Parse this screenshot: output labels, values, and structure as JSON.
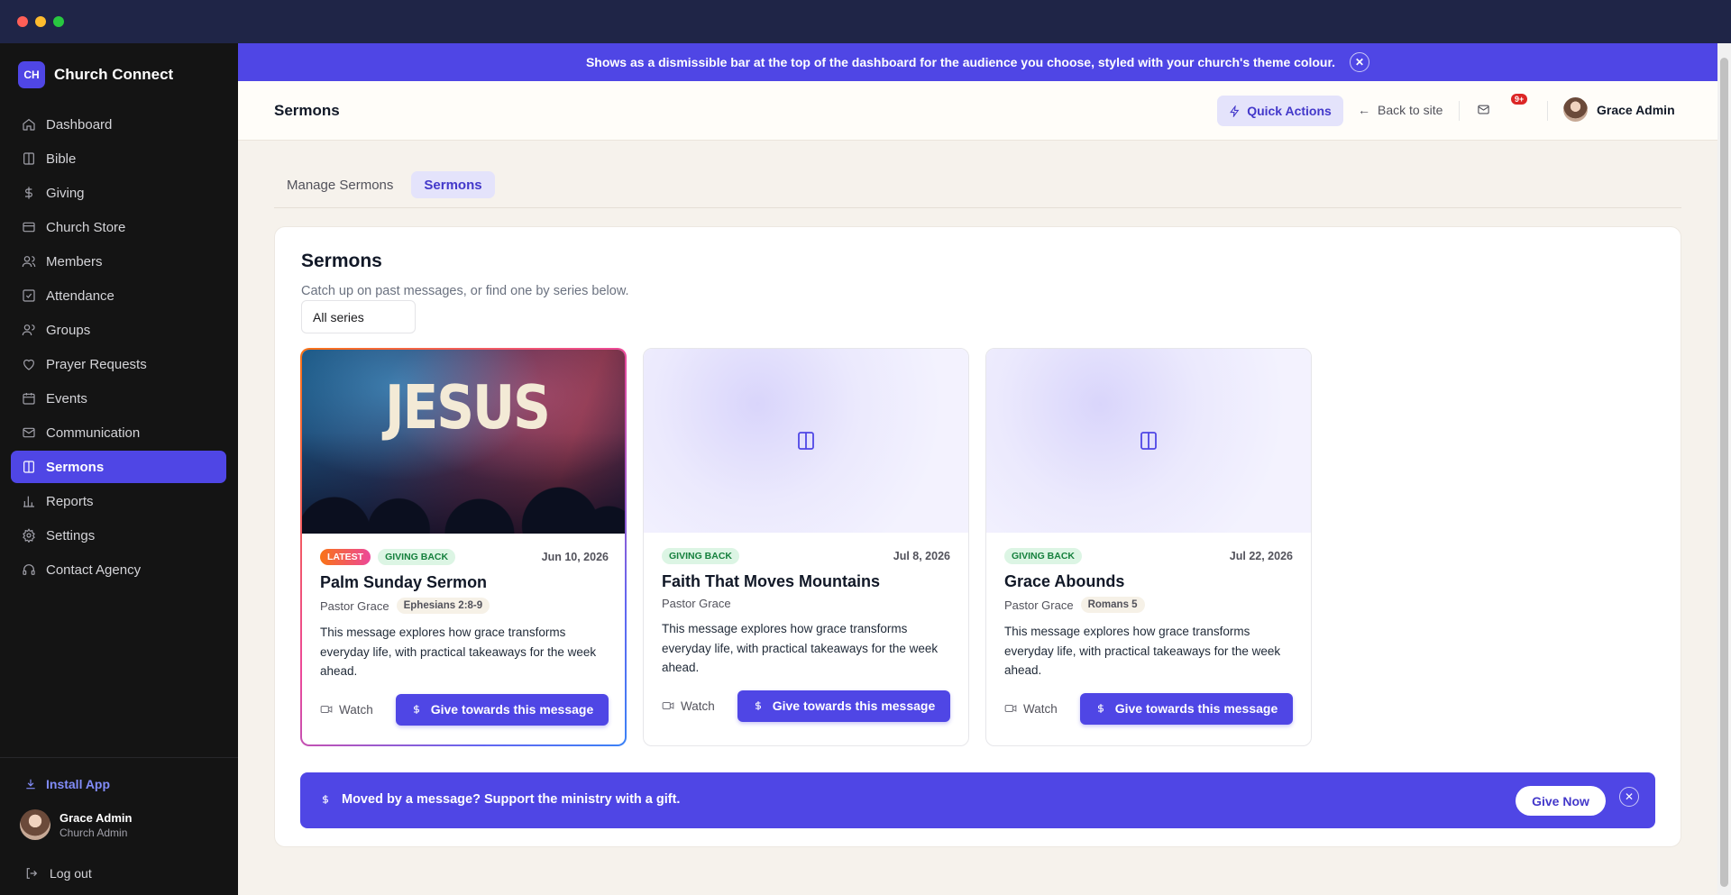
{
  "app": {
    "name": "Church Connect",
    "logo_initials": "CH"
  },
  "sidebar": {
    "items": [
      {
        "label": "Dashboard",
        "icon": "home-icon"
      },
      {
        "label": "Bible",
        "icon": "book-icon"
      },
      {
        "label": "Giving",
        "icon": "dollar-icon"
      },
      {
        "label": "Church Store",
        "icon": "card-icon"
      },
      {
        "label": "Members",
        "icon": "users-icon"
      },
      {
        "label": "Attendance",
        "icon": "check-square-icon"
      },
      {
        "label": "Groups",
        "icon": "group-icon"
      },
      {
        "label": "Prayer Requests",
        "icon": "heart-icon"
      },
      {
        "label": "Events",
        "icon": "calendar-icon"
      },
      {
        "label": "Communication",
        "icon": "mail-icon"
      },
      {
        "label": "Sermons",
        "icon": "book-open-icon",
        "active": true
      },
      {
        "label": "Reports",
        "icon": "bar-chart-icon"
      },
      {
        "label": "Settings",
        "icon": "gear-icon"
      },
      {
        "label": "Contact Agency",
        "icon": "headset-icon"
      }
    ],
    "install_label": "Install App",
    "user": {
      "name": "Grace Admin",
      "role": "Church Admin"
    },
    "logout_label": "Log out"
  },
  "announcement": {
    "text": "Shows as a dismissible bar at the top of the dashboard for the audience you choose, styled with your church's theme colour.",
    "close": "✕"
  },
  "header": {
    "title": "Sermons",
    "quick_actions": "Quick Actions",
    "back_to_site": "Back to site",
    "notification_badge": "9+",
    "user_name": "Grace Admin"
  },
  "tabs": [
    {
      "label": "Manage Sermons",
      "active": false
    },
    {
      "label": "Sermons",
      "active": true
    }
  ],
  "panel": {
    "title": "Sermons",
    "subtitle": "Catch up on past messages, or find one by series below.",
    "series_filter": "All series"
  },
  "cards": [
    {
      "latest_badge": "LATEST",
      "series": "GIVING BACK",
      "date": "Jun 10, 2026",
      "title": "Palm Sunday Sermon",
      "speaker": "Pastor Grace",
      "scripture": "Ephesians 2:8-9",
      "description": "This message explores how grace transforms everyday life, with practical takeaways for the week ahead.",
      "watch": "Watch",
      "give": "Give towards this message",
      "image_text": "JESUS"
    },
    {
      "series": "GIVING BACK",
      "date": "Jul 8, 2026",
      "title": "Faith That Moves Mountains",
      "speaker": "Pastor Grace",
      "description": "This message explores how grace transforms everyday life, with practical takeaways for the week ahead.",
      "watch": "Watch",
      "give": "Give towards this message"
    },
    {
      "series": "GIVING BACK",
      "date": "Jul 22, 2026",
      "title": "Grace Abounds",
      "speaker": "Pastor Grace",
      "scripture": "Romans 5",
      "description": "This message explores how grace transforms everyday life, with practical takeaways for the week ahead.",
      "watch": "Watch",
      "give": "Give towards this message"
    }
  ],
  "support_bar": {
    "text": "Moved by a message? Support the ministry with a gift.",
    "button": "Give Now",
    "close": "✕"
  },
  "colors": {
    "accent": "#4f46e5",
    "sidebar_bg": "#141414",
    "page_bg": "#f6f2ec"
  }
}
